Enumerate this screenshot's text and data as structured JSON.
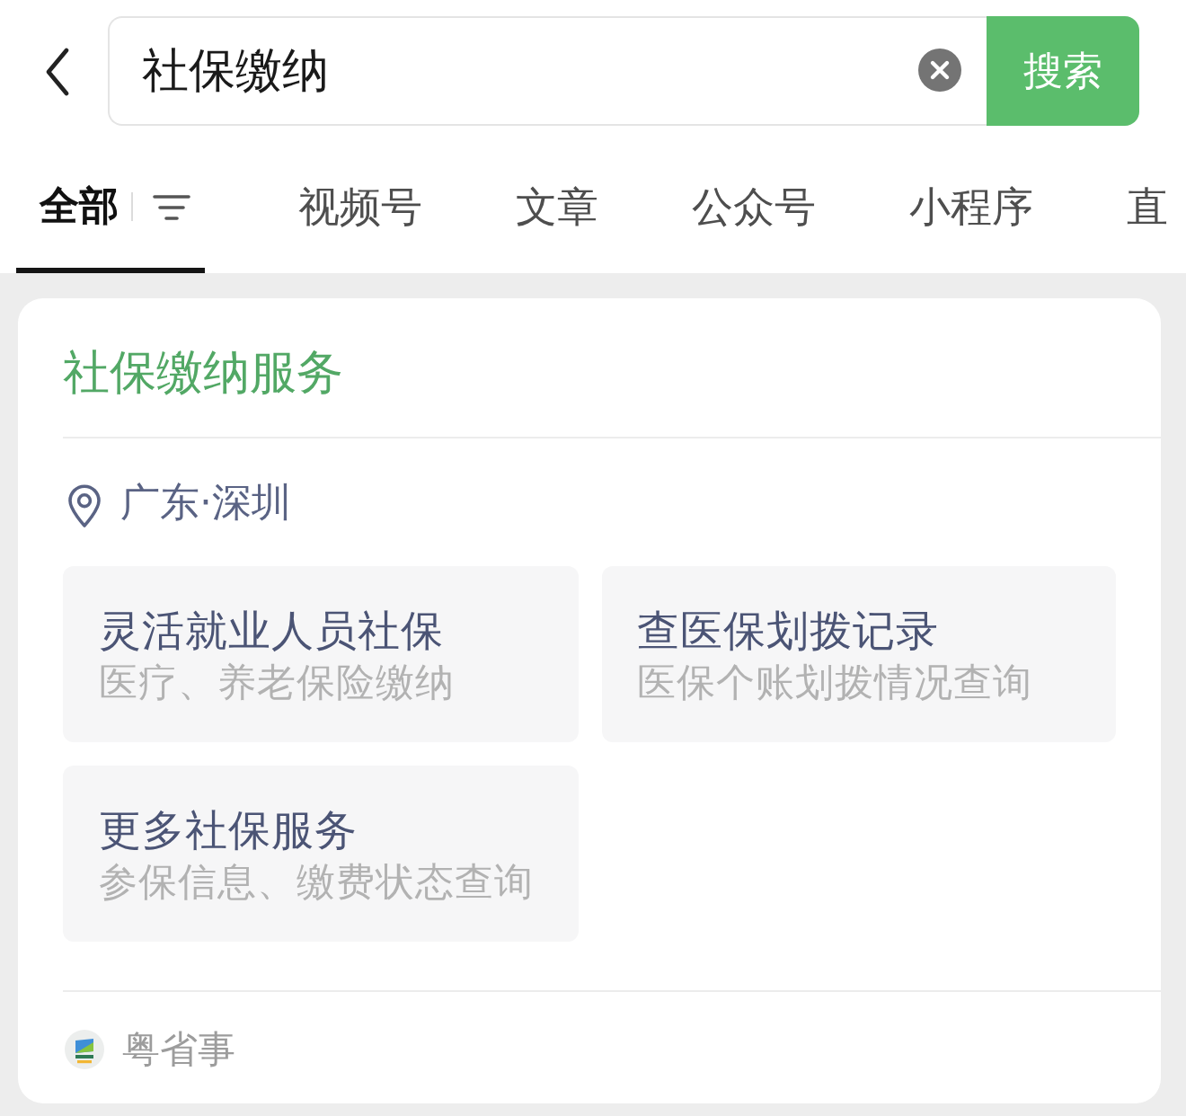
{
  "search": {
    "value": "社保缴纳",
    "button": "搜索"
  },
  "tabs": [
    {
      "label": "全部",
      "selected": true
    },
    {
      "label": "视频号",
      "selected": false
    },
    {
      "label": "文章",
      "selected": false
    },
    {
      "label": "公众号",
      "selected": false
    },
    {
      "label": "小程序",
      "selected": false
    },
    {
      "label": "直",
      "selected": false
    }
  ],
  "card": {
    "title": "社保缴纳服务",
    "location": "广东·深圳",
    "services": [
      {
        "title": "灵活就业人员社保",
        "subtitle": "医疗、养老保险缴纳"
      },
      {
        "title": "查医保划拨记录",
        "subtitle": "医保个账划拨情况查询"
      },
      {
        "title": "更多社保服务",
        "subtitle": "参保信息、缴费状态查询"
      }
    ],
    "source": "粤省事"
  }
}
